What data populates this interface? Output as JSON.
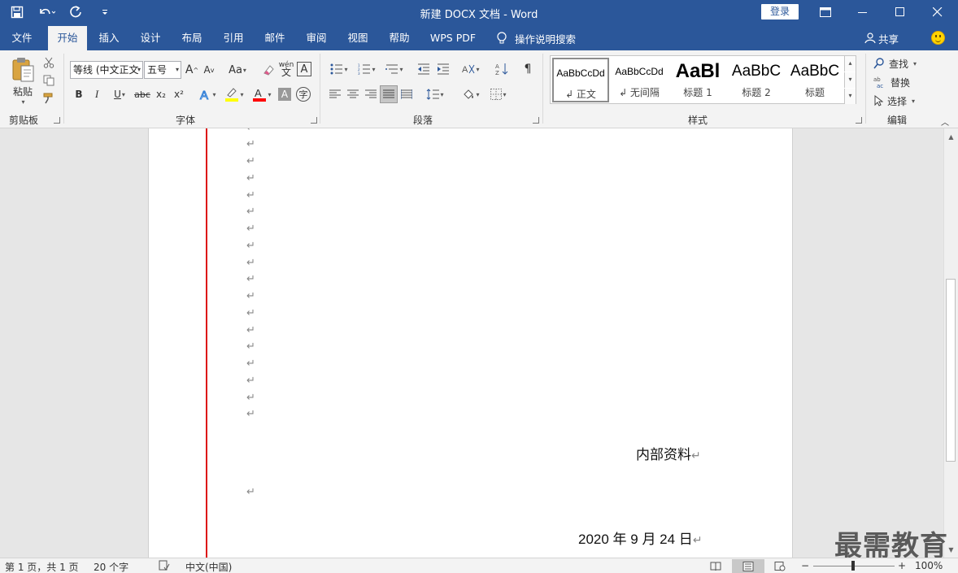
{
  "titlebar": {
    "title": "新建 DOCX 文档  -  Word",
    "login_label": "登录",
    "qat": [
      "save-icon",
      "undo-icon",
      "redo-icon",
      "customize-qat-icon"
    ]
  },
  "tabs": {
    "items": [
      "文件",
      "开始",
      "插入",
      "设计",
      "布局",
      "引用",
      "邮件",
      "审阅",
      "视图",
      "帮助",
      "WPS PDF"
    ],
    "active": "开始",
    "tellme_label": "操作说明搜索",
    "share_label": "共享"
  },
  "ribbon": {
    "clipboard": {
      "paste_label": "粘贴",
      "group_label": "剪贴板"
    },
    "font": {
      "font_name": "等线 (中文正文",
      "font_size": "五号",
      "grow": "A",
      "shrink": "A",
      "change_case": "Aa",
      "bold": "B",
      "italic": "I",
      "underline": "U",
      "strike": "abc",
      "subscript": "x₂",
      "superscript": "x²",
      "group_label": "字体"
    },
    "paragraph": {
      "group_label": "段落"
    },
    "styles": {
      "items": [
        {
          "sample": "AaBbCcDd",
          "name": "↲ 正文"
        },
        {
          "sample": "AaBbCcDd",
          "name": "↲ 无间隔"
        },
        {
          "sample": "AaBl",
          "name": "标题 1"
        },
        {
          "sample": "AaBbC",
          "name": "标题 2"
        },
        {
          "sample": "AaBbC",
          "name": "标题"
        }
      ],
      "group_label": "样式"
    },
    "editing": {
      "find_label": "查找",
      "replace_label": "替换",
      "select_label": "选择",
      "group_label": "编辑"
    }
  },
  "document": {
    "paragraph_mark": "↵",
    "internal_label": "内部资料",
    "date_label": "2020 年 9 月 24 日"
  },
  "statusbar": {
    "page_info": "第 1 页，共 1 页",
    "word_count": "20 个字",
    "language": "中文(中国)",
    "zoom": "100%",
    "minus": "−",
    "plus": "+"
  },
  "watermark": "最需教育",
  "colors": {
    "accent": "#2b579a",
    "margin_line": "#dd1111",
    "highlight": "#ffff00",
    "font_color": "#ff0000"
  }
}
